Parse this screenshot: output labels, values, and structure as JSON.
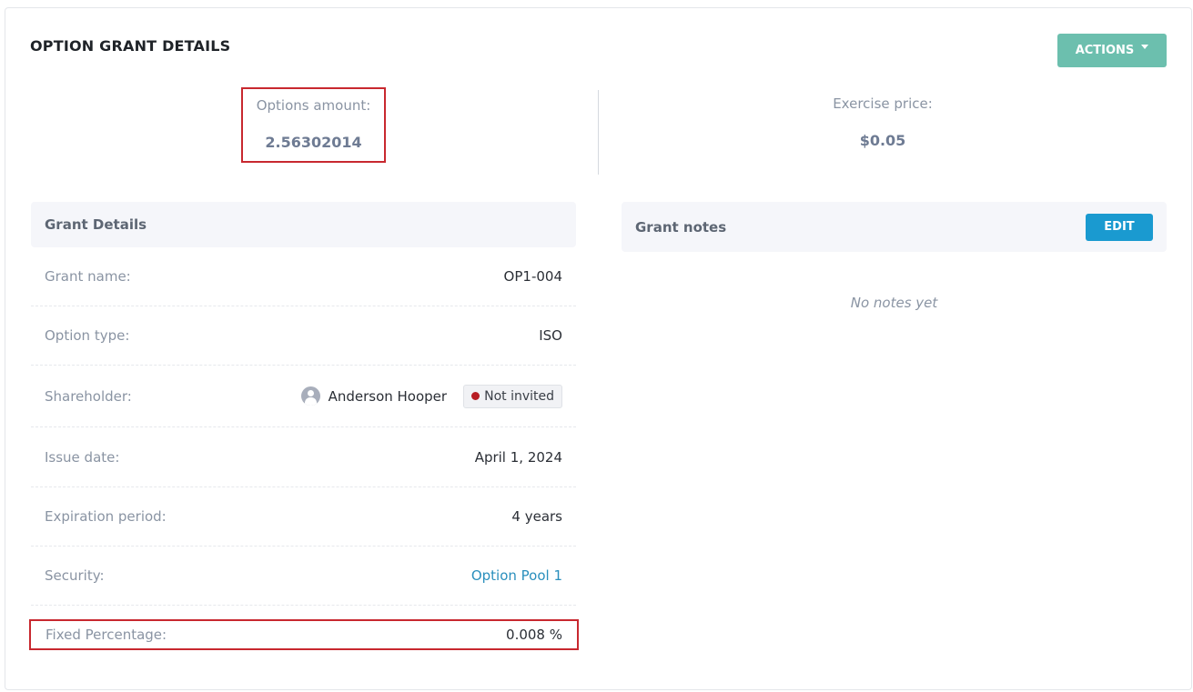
{
  "header": {
    "title": "OPTION GRANT DETAILS",
    "actions_label": "ACTIONS"
  },
  "stats": {
    "options_amount": {
      "label": "Options amount:",
      "value": "2.56302014"
    },
    "exercise_price": {
      "label": "Exercise price:",
      "value": "$0.05"
    }
  },
  "grant_details": {
    "title": "Grant Details",
    "rows": {
      "grant_name": {
        "label": "Grant name:",
        "value": "OP1-004"
      },
      "option_type": {
        "label": "Option type:",
        "value": "ISO"
      },
      "shareholder": {
        "label": "Shareholder:",
        "name": "Anderson Hooper",
        "status": "Not invited",
        "status_color": "#b81d24",
        "avatar_icon": "user-icon"
      },
      "issue_date": {
        "label": "Issue date:",
        "value": "April 1, 2024"
      },
      "expiration_period": {
        "label": "Expiration period:",
        "value": "4 years"
      },
      "security": {
        "label": "Security:",
        "value": "Option Pool 1"
      },
      "fixed_percentage": {
        "label": "Fixed Percentage:",
        "value": "0.008 %"
      }
    }
  },
  "grant_notes": {
    "title": "Grant notes",
    "edit_label": "EDIT",
    "empty_text": "No notes yet"
  },
  "colors": {
    "actions_button": "#6cbfae",
    "edit_button": "#1a9ad0",
    "link": "#2a8fbd",
    "highlight_border": "#c8282f"
  }
}
